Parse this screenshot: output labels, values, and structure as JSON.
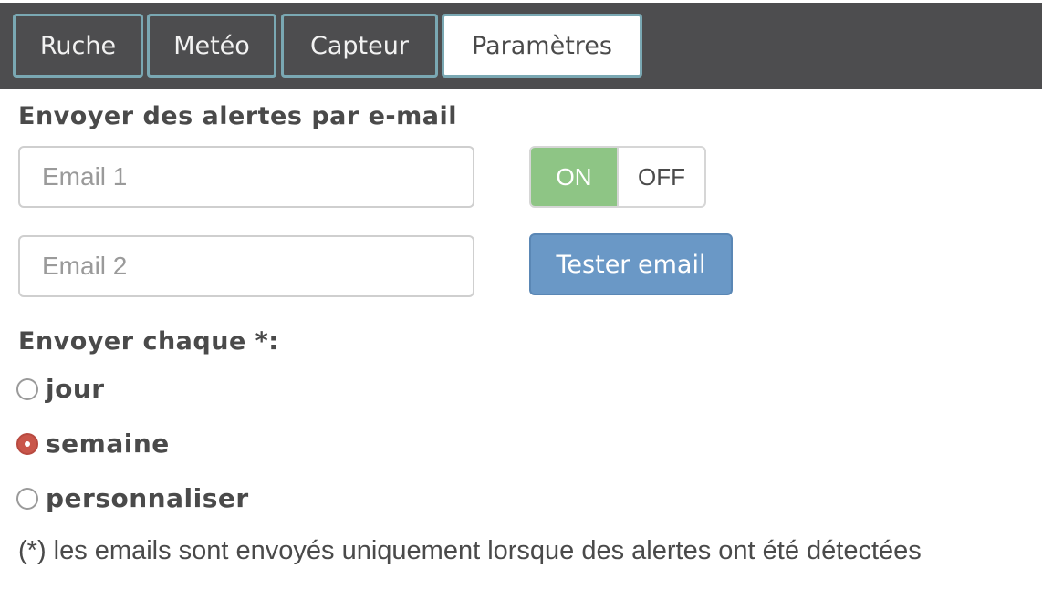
{
  "tabs": [
    {
      "label": "Ruche"
    },
    {
      "label": "Metéo"
    },
    {
      "label": "Capteur"
    },
    {
      "label": "Paramètres",
      "active": true
    }
  ],
  "alerts": {
    "heading": "Envoyer des alertes par e-mail",
    "email1_placeholder": "Email 1",
    "email2_placeholder": "Email 2",
    "toggle_on": "ON",
    "toggle_off": "OFF",
    "toggle_state": "ON",
    "test_button": "Tester email"
  },
  "frequency": {
    "heading": "Envoyer chaque *:",
    "options": [
      {
        "label": "jour",
        "checked": false
      },
      {
        "label": "semaine",
        "checked": true
      },
      {
        "label": "personnaliser",
        "checked": false
      }
    ]
  },
  "note": "(*) les emails sont envoyés uniquement lorsque des alertes ont été détectées",
  "colors": {
    "topbar": "#4d4d4f",
    "tab_border": "#7aa8b3",
    "toggle_on": "#8ec585",
    "test_button": "#6a98c6",
    "radio_checked": "#c9564a"
  }
}
